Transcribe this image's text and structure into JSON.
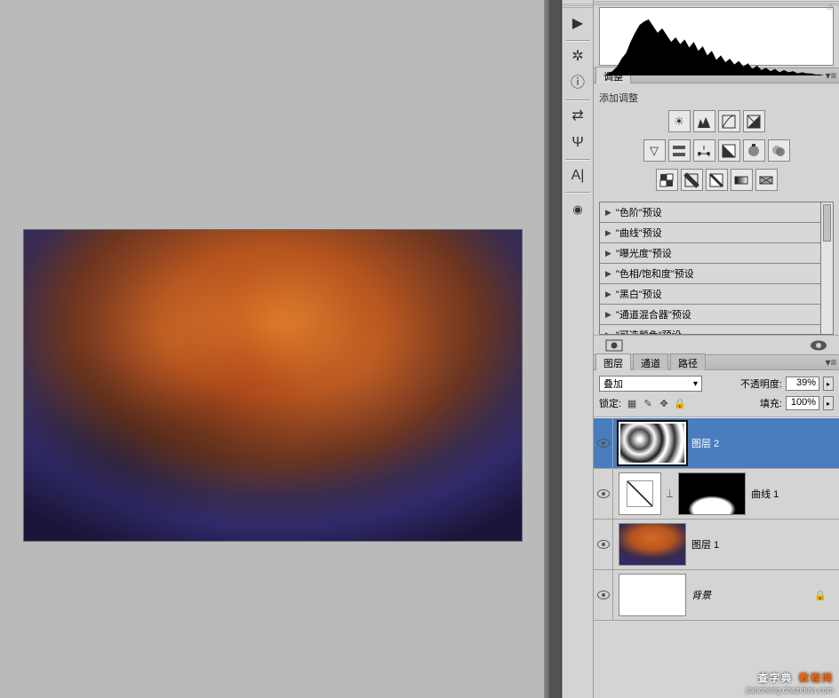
{
  "toolbar": {
    "icons": [
      "play",
      "wheel",
      "info",
      "swap",
      "usb",
      "text",
      "camera"
    ]
  },
  "tabs": {
    "adjust": "调整"
  },
  "adjust": {
    "add_label": "添加调整",
    "presets": [
      "\"色阶\"预设",
      "\"曲线\"预设",
      "\"曝光度\"预设",
      "\"色相/饱和度\"预设",
      "\"黑白\"预设",
      "\"通道混合器\"预设",
      "\"可选颜色\"预设"
    ]
  },
  "layerTabs": {
    "layers": "图层",
    "channels": "通道",
    "paths": "路径"
  },
  "layersCtrl": {
    "blend_mode": "叠加",
    "opacity_label": "不透明度:",
    "opacity_value": "39%",
    "lock_label": "锁定:",
    "fill_label": "填充:",
    "fill_value": "100%"
  },
  "layers": [
    {
      "name": "图层 2",
      "selected": true
    },
    {
      "name": "曲线 1"
    },
    {
      "name": "图层 1"
    },
    {
      "name": "背景"
    }
  ],
  "watermark": {
    "line1a": "查字典",
    "line1b": "教程网",
    "line2": "jiaocheng.chazidian.com"
  }
}
